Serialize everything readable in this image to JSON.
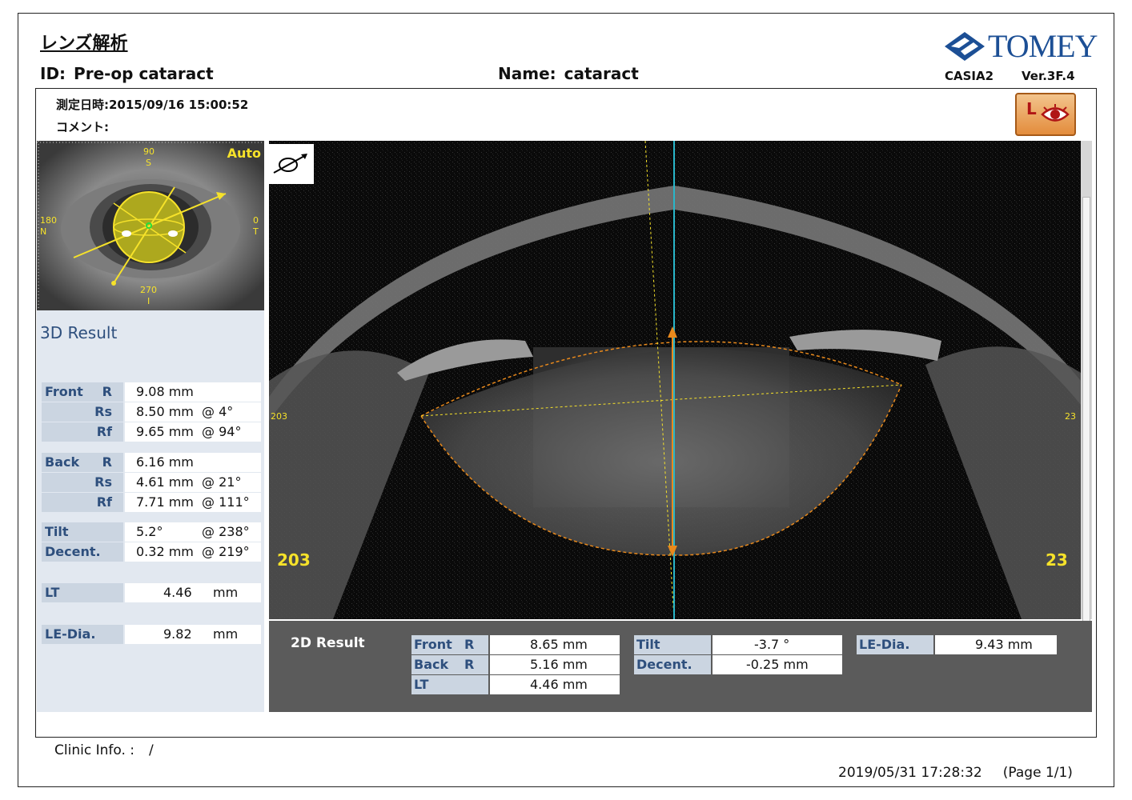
{
  "report": {
    "title": "レンズ解析",
    "id_label": "ID:",
    "id_value": "Pre-op cataract",
    "name_label": "Name:",
    "name_value": "cataract",
    "logo_text": "TOMEY",
    "device": "CASIA2",
    "version": "Ver.3F.4",
    "measure_label": "測定日時:",
    "measure_value": "2015/09/16 15:00:52",
    "comment_label": "コメント:",
    "eye_badge": "L",
    "clinic": "Clinic Info. :",
    "clinic_value": "/",
    "printed": "2019/05/31 17:28:32",
    "page": "(Page 1/1)"
  },
  "eye_image": {
    "mode": "Auto",
    "top_deg": "90",
    "top_letter": "S",
    "left_deg": "180",
    "left_letter": "N",
    "right_deg": "0",
    "right_letter": "T",
    "bottom_deg": "270",
    "bottom_letter": "I"
  },
  "result3d": {
    "heading": "3D Result",
    "rows": [
      {
        "group": "Front",
        "sub": "R",
        "value": "9.08 mm",
        "axis": ""
      },
      {
        "group": "",
        "sub": "Rs",
        "value": "8.50 mm",
        "axis": "@ 4°"
      },
      {
        "group": "",
        "sub": "Rf",
        "value": "9.65 mm",
        "axis": "@ 94°"
      },
      {
        "group": "Back",
        "sub": "R",
        "value": "6.16 mm",
        "axis": ""
      },
      {
        "group": "",
        "sub": "Rs",
        "value": "4.61 mm",
        "axis": "@ 21°"
      },
      {
        "group": "",
        "sub": "Rf",
        "value": "7.71 mm",
        "axis": "@ 111°"
      },
      {
        "group": "Tilt",
        "sub": "",
        "value": "5.2°",
        "axis": "@ 238°"
      },
      {
        "group": "Decent.",
        "sub": "",
        "value": "0.32 mm",
        "axis": "@ 219°"
      },
      {
        "group": "LT",
        "sub": "",
        "value": "4.46",
        "axis": "mm"
      },
      {
        "group": "LE-Dia.",
        "sub": "",
        "value": "9.82",
        "axis": "mm"
      }
    ]
  },
  "scan": {
    "left_mark_small": "203",
    "right_mark_small": "23",
    "left_mark": "203",
    "right_mark": "23"
  },
  "result2d": {
    "heading": "2D Result",
    "col1": [
      {
        "k": "Front",
        "sub": "R",
        "v": "8.65 mm"
      },
      {
        "k": "Back",
        "sub": "R",
        "v": "5.16 mm"
      },
      {
        "k": "LT",
        "sub": "",
        "v": "4.46 mm"
      }
    ],
    "col2": [
      {
        "k": "Tilt",
        "v": "-3.7 °"
      },
      {
        "k": "Decent.",
        "v": "-0.25 mm"
      }
    ],
    "col3": [
      {
        "k": "LE-Dia.",
        "v": "9.43 mm"
      }
    ]
  }
}
